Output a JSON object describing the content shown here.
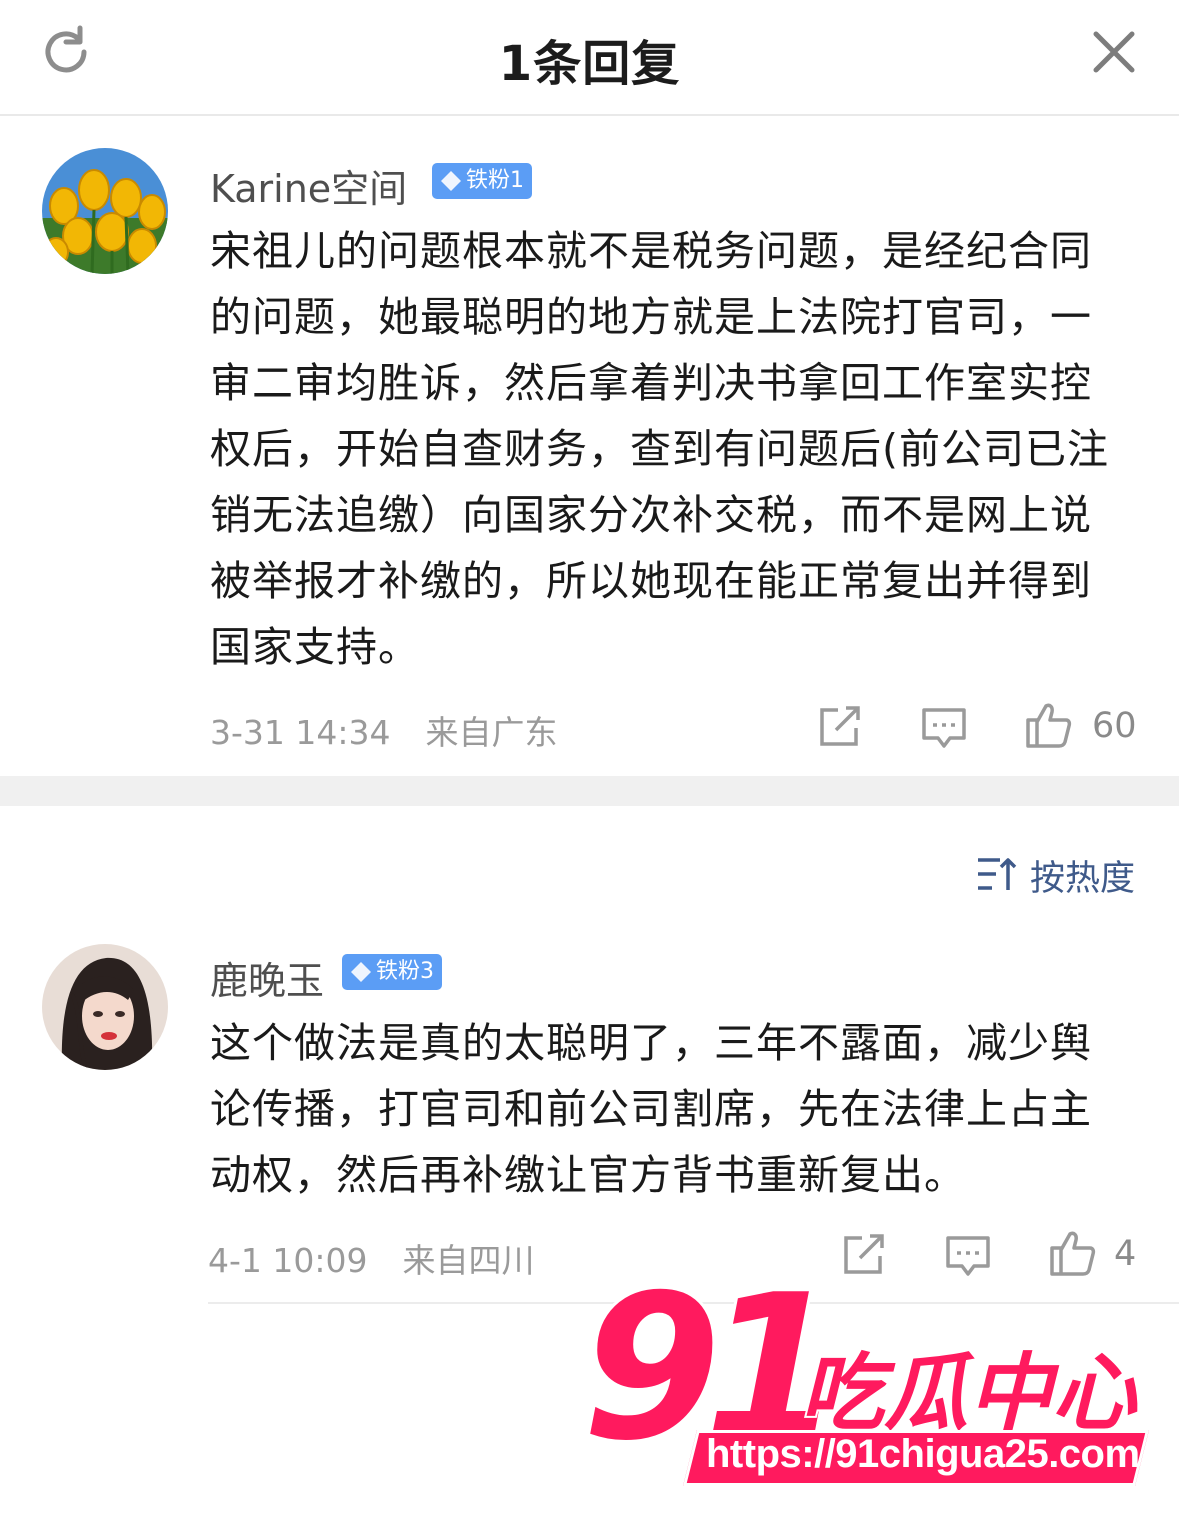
{
  "header": {
    "title": "1条回复",
    "refresh_icon": "refresh-icon",
    "close_icon": "close-icon"
  },
  "comments": [
    {
      "username": "Karine空间",
      "badge": "铁粉1",
      "avatar": "tulip-avatar",
      "content": "宋祖儿的问题根本就不是税务问题，是经纪合同的问题，她最聪明的地方就是上法院打官司，一审二审均胜诉，然后拿着判决书拿回工作室实控权后，开始自查财务，查到有问题后(前公司已注销无法追缴）向国家分次补交税，而不是网上说被举报才补缴的，所以她现在能正常复出并得到国家支持。",
      "time": "3-31 14:34",
      "location": "来自广东",
      "likes": "60"
    },
    {
      "username": "鹿晚玉",
      "badge": "铁粉3",
      "avatar": "portrait-avatar",
      "content": "这个做法是真的太聪明了，三年不露面，减少舆论传播，打官司和前公司割席，先在法律上占主动权，然后再补缴让官方背书重新复出。",
      "time": "4-1 10:09",
      "location": "来自四川",
      "likes": "4"
    }
  ],
  "sort": {
    "label": "按热度",
    "icon": "sort-icon"
  },
  "watermark": {
    "number": "91",
    "name": "吃瓜中心",
    "url": "https://91chigua25.com"
  },
  "colors": {
    "badge": "#5b9df5",
    "sort_text": "#3f5a8a",
    "watermark": "#ff1a5e"
  }
}
